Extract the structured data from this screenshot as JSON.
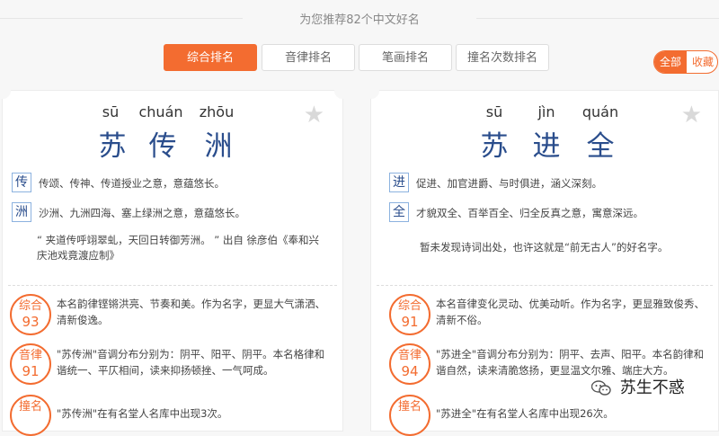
{
  "header": {
    "subtitle": "为您推荐82个中文好名"
  },
  "tabs": [
    {
      "label": "综合排名",
      "active": true
    },
    {
      "label": "音律排名",
      "active": false
    },
    {
      "label": "笔画排名",
      "active": false
    },
    {
      "label": "撞名次数排名",
      "active": false
    }
  ],
  "toggle": {
    "all": "全部",
    "fav": "收藏"
  },
  "cards": [
    {
      "pinyin": [
        "sū",
        "chuán",
        "zhōu"
      ],
      "hanzi": [
        "苏",
        "传",
        "洲"
      ],
      "meanings": [
        {
          "char": "传",
          "text": "传颂、传神、传道授业之意，意蕴悠长。"
        },
        {
          "char": "洲",
          "text": "沙洲、九洲四海、塞上绿洲之意，意蕴悠长。"
        }
      ],
      "poem_line1": "“ 夹道传呼翊翠虬，天回日转御芳洲。 ” 出自 徐彦伯《奉和兴",
      "poem_line2": "庆池戏竟渡应制》",
      "scores": [
        {
          "label": "综合",
          "value": "93",
          "line1": "本名韵律铿锵洪亮、节奏和美。作为名字，更显大气潇洒、",
          "line2": "清新俊逸。"
        },
        {
          "label": "音律",
          "value": "91",
          "line1": "\"苏传洲\"音调分布分别为：阴平、阳平、阴平。本名格律和",
          "line2": "谐统一、平仄相间，读来抑扬顿挫、一气呵成。"
        },
        {
          "label": "撞名",
          "value": "",
          "line1": "\"苏传洲\"在有名堂人名库中出现3次。",
          "line2": ""
        }
      ]
    },
    {
      "pinyin": [
        "sū",
        "jìn",
        "quán"
      ],
      "hanzi": [
        "苏",
        "进",
        "全"
      ],
      "meanings": [
        {
          "char": "进",
          "text": "促进、加官进爵、与时俱进，涵义深刻。"
        },
        {
          "char": "全",
          "text": "才貌双全、百举百全、归全反真之意，寓意深远。"
        }
      ],
      "poem_line1": "暂未发现诗词出处，也许这就是“前无古人”的好名字。",
      "poem_line2": "",
      "scores": [
        {
          "label": "综合",
          "value": "91",
          "line1": "本名音律变化灵动、优美动听。作为名字，更显雅致俊秀、",
          "line2": "清新不俗。"
        },
        {
          "label": "音律",
          "value": "94",
          "line1": "\"苏进全\"音调分布分别为：阴平、去声、阳平。本名韵律和",
          "line2": "谐自然，读来清脆悠扬，更显温文尔雅、端庄大方。"
        },
        {
          "label": "撞名",
          "value": "",
          "line1": "\"苏进全\"在有名堂人名库中出现26次。",
          "line2": ""
        }
      ]
    }
  ],
  "watermark": {
    "text": "苏生不惑",
    "icon": "wechat-icon"
  },
  "colors": {
    "accent": "#f36c30",
    "name": "#2a4d8c",
    "box_border": "#8cb2df"
  }
}
